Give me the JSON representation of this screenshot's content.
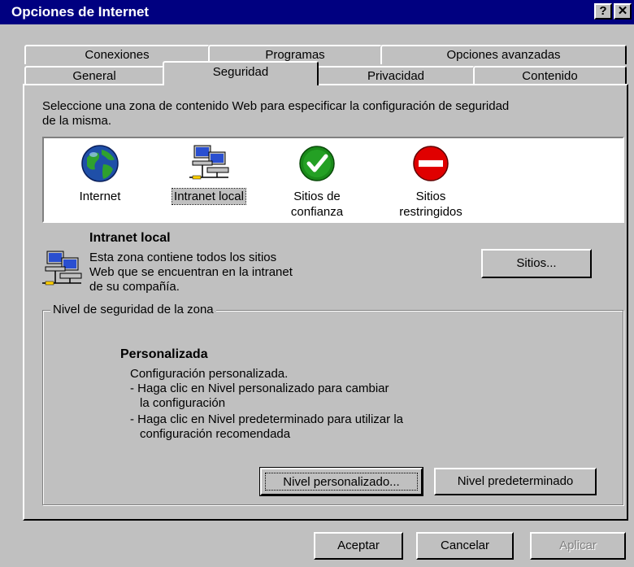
{
  "window": {
    "title": "Opciones de Internet",
    "help_button": "?",
    "close_button": "✕"
  },
  "tabs": {
    "row_back": [
      "Conexiones",
      "Programas",
      "Opciones avanzadas"
    ],
    "row_front": [
      "General",
      "Seguridad",
      "Privacidad",
      "Contenido"
    ],
    "active": "Seguridad"
  },
  "intro_text": {
    "line1": "Seleccione una zona de contenido Web para especificar la configuración de seguridad",
    "line2": "de la misma."
  },
  "zones": [
    {
      "label_1": "Internet",
      "label_2": "",
      "icon": "globe-icon"
    },
    {
      "label_1": "Intranet local",
      "label_2": "",
      "icon": "network-computers-icon",
      "selected": true
    },
    {
      "label_1": "Sitios de",
      "label_2": "confianza",
      "icon": "green-check-icon"
    },
    {
      "label_1": "Sitios",
      "label_2": "restringidos",
      "icon": "red-no-entry-icon"
    }
  ],
  "selected_zone": {
    "name": "Intranet local",
    "desc_1": "Esta zona contiene todos los sitios",
    "desc_2": "Web que se encuentran en la intranet",
    "desc_3": "de su compañía.",
    "sites_button": "Sitios..."
  },
  "security_level": {
    "group_label": "Nivel de seguridad de la zona",
    "level_name": "Personalizada",
    "line1": "Configuración personalizada.",
    "line2": "- Haga clic en Nivel personalizado para cambiar",
    "line3": "la configuración",
    "line4": "- Haga clic en Nivel predeterminado para utilizar la",
    "line5": "configuración recomendada",
    "custom_button": "Nivel personalizado...",
    "default_button": "Nivel predeterminado"
  },
  "footer": {
    "ok": "Aceptar",
    "cancel": "Cancelar",
    "apply": "Aplicar"
  },
  "colors": {
    "titlebar": "#000080",
    "face": "#c0c0c0",
    "check_green": "#1a8a1a",
    "stop_red": "#e00000"
  }
}
